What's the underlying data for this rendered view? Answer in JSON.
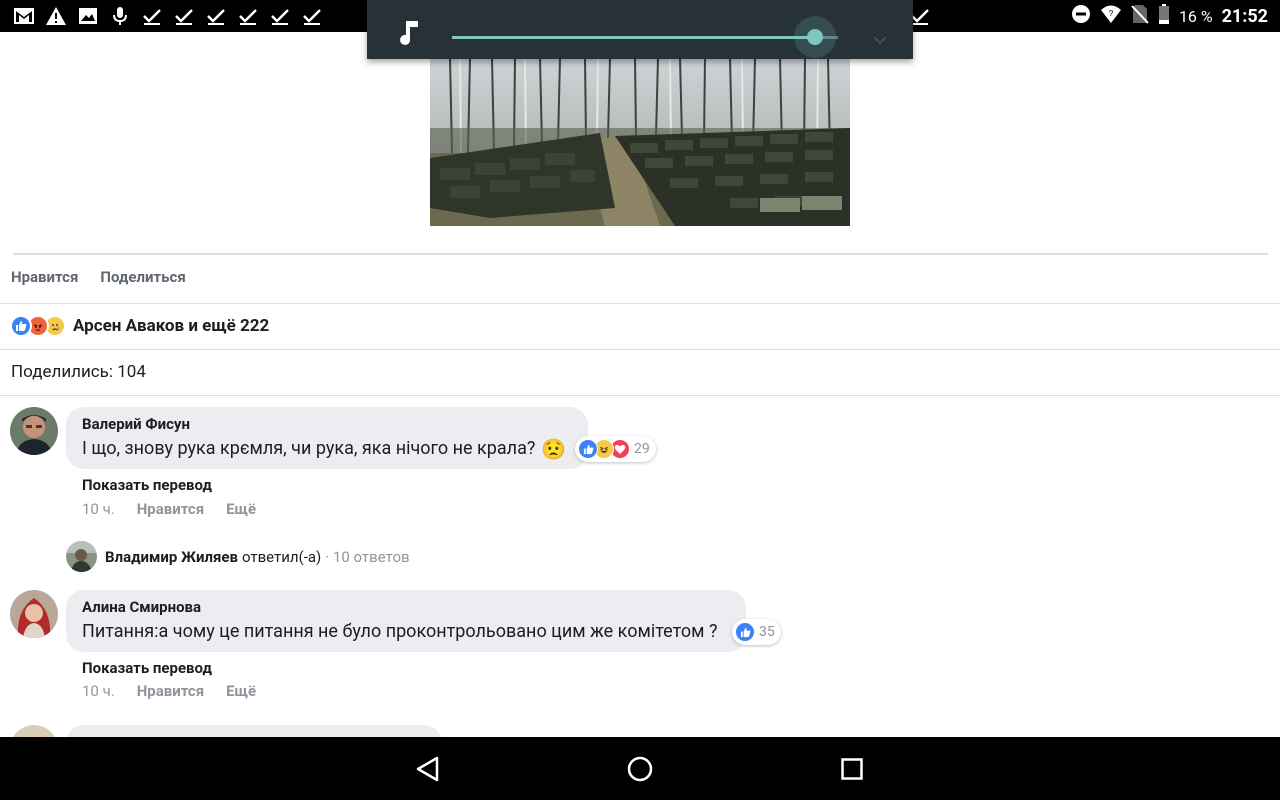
{
  "status_bar": {
    "left_icons": [
      "gmail-icon",
      "warning-icon",
      "image-icon",
      "mic-icon",
      "check-icon",
      "check-icon",
      "check-icon",
      "check-icon",
      "check-icon",
      "check-icon"
    ],
    "battery_percent": "16 %",
    "time": "21:52"
  },
  "volume": {
    "stream_icon": "music-note-icon",
    "level_fraction": 0.94
  },
  "post": {
    "actions": {
      "like": "Нравится",
      "share": "Поделиться"
    },
    "reactions": {
      "icons": [
        "like",
        "angry",
        "sad"
      ],
      "summary": "Арсен Аваков и ещё 222"
    },
    "shares_text": "Поделились: 104"
  },
  "comments": [
    {
      "author": "Валерий Фисун",
      "text": "І що, знову рука крємля, чи рука, яка нічого не крала?",
      "emoji": "😟",
      "reactions": [
        "like",
        "haha",
        "love"
      ],
      "reaction_count": "29",
      "translate": "Показать перевод",
      "time": "10 ч.",
      "like": "Нравится",
      "more": "Ещё"
    },
    {
      "author": "Алина Смирнова",
      "text": "Питання:а чому це питання не було проконтрольовано цим же комітетом ?",
      "emoji": "",
      "reactions": [
        "like"
      ],
      "reaction_count": "35",
      "translate": "Показать перевод",
      "time": "10 ч.",
      "like": "Нравится",
      "more": "Ещё"
    }
  ],
  "reply": {
    "name": "Владимир Жиляев",
    "action": "ответил(-а)",
    "count": "· 10 ответов"
  },
  "colors": {
    "like_blue": "#3b82f6",
    "angry_orange": "#f0633b",
    "sad_yellow": "#f7c948",
    "love_red": "#f33e58",
    "volume_accent": "#7ec7c1",
    "volume_bg": "#263238"
  }
}
